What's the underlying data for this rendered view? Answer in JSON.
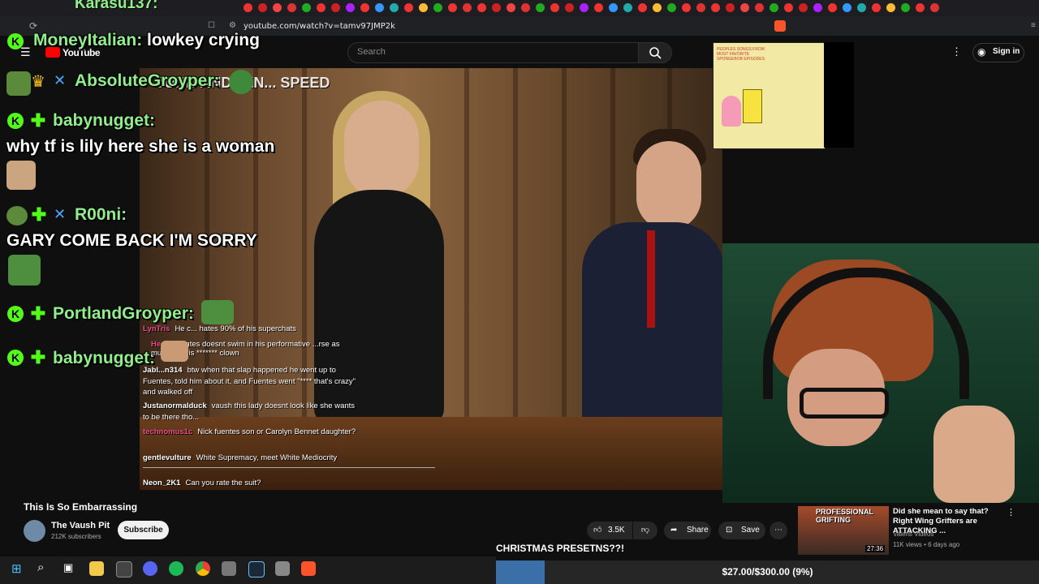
{
  "browser": {
    "url": "youtube.com/watch?v=tamv97JMP2k",
    "top_username_partial": "Karasu137:"
  },
  "youtube": {
    "logo_text": "YouTube",
    "search_placeholder": "Search",
    "signin_label": "Sign in",
    "video_title": "This Is So Embarrassing",
    "channel_name": "The Vaush Pit",
    "subscribers": "212K subscribers",
    "subscribe_label": "Subscribe",
    "likes": "3.5K",
    "share_label": "Share",
    "save_label": "Save",
    "recommended": {
      "title": "Did she mean to say that? Right Wing Grifters are ATTACKING ...",
      "channel": "Valenti Videos",
      "meta": "11K views • 6 days ago",
      "duration": "27:36",
      "thumb_caption": "PROFESSIONAL GRIFTING"
    }
  },
  "video_overlay_text": "JOHN AND JEN... SPEED",
  "big_chat": [
    {
      "user": "MoneyItalian:",
      "message": "lowkey crying"
    },
    {
      "user": "AbsoluteGroyper:",
      "message": ""
    },
    {
      "user": "babynugget:",
      "message": "why tf is lily here she is a woman"
    },
    {
      "user": "R00ni:",
      "message": "GARY COME BACK I'M SORRY"
    },
    {
      "user": "PortlandGroyper:",
      "message": ""
    },
    {
      "user": "babynugget:",
      "message": ""
    }
  ],
  "small_chat": [
    {
      "user": "LynTris",
      "message": "He c... hates 90% of his superchats"
    },
    {
      "user": "He...",
      "message": "Fuentes doesnt swim in his performative ...rse as much as this ******* clown"
    },
    {
      "user": "Jabl...n314",
      "message": "btw when that slap happened he went up to Fuentes, told him about it, and Fuentes went \"**** that's crazy\" and walked off"
    },
    {
      "user": "Justanormalduck",
      "message": "vaush this lady doesnt look like she wants to be there tho..."
    },
    {
      "user": "technomus1c",
      "message": "Nick fuentes son or Carolyn Bennet daughter?"
    },
    {
      "user": "gentlevulture",
      "message": "White Supremacy, meet White Mediocrity"
    },
    {
      "user": "Neon_2K1",
      "message": "Can you rate the suit?"
    }
  ],
  "thumbnail_text": "PEOPLES SONGS FROM MOST FAVORITE SPONGEBOB EPISODES",
  "donation_goal": {
    "label": "CHRISTMAS PRESETNS??!",
    "text": "$27.00/$300.00 (9%)",
    "current": 27,
    "target": 300,
    "fraction": 0.09
  },
  "colors": {
    "kick_green": "#53fc18",
    "username_green": "#8ff08a",
    "goal_fill": "#3a6fa8"
  }
}
